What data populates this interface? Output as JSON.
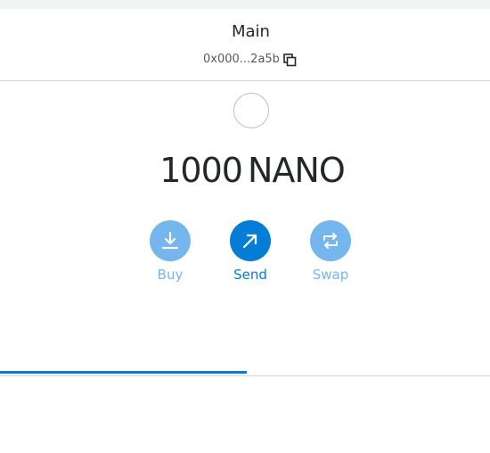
{
  "account": {
    "name": "Main",
    "address_short": "0x000...2a5b"
  },
  "balance": {
    "amount": "1000",
    "symbol": "NANO"
  },
  "actions": {
    "buy_label": "Buy",
    "send_label": "Send",
    "swap_label": "Swap"
  },
  "icons": {
    "copy": "copy-icon",
    "buy": "download-arrow-icon",
    "send": "arrow-up-right-icon",
    "swap": "swap-arrows-icon"
  },
  "colors": {
    "accent": "#037dd6",
    "accent_light": "#75b6ee",
    "text": "#24272a",
    "border": "#d6d9dc"
  }
}
